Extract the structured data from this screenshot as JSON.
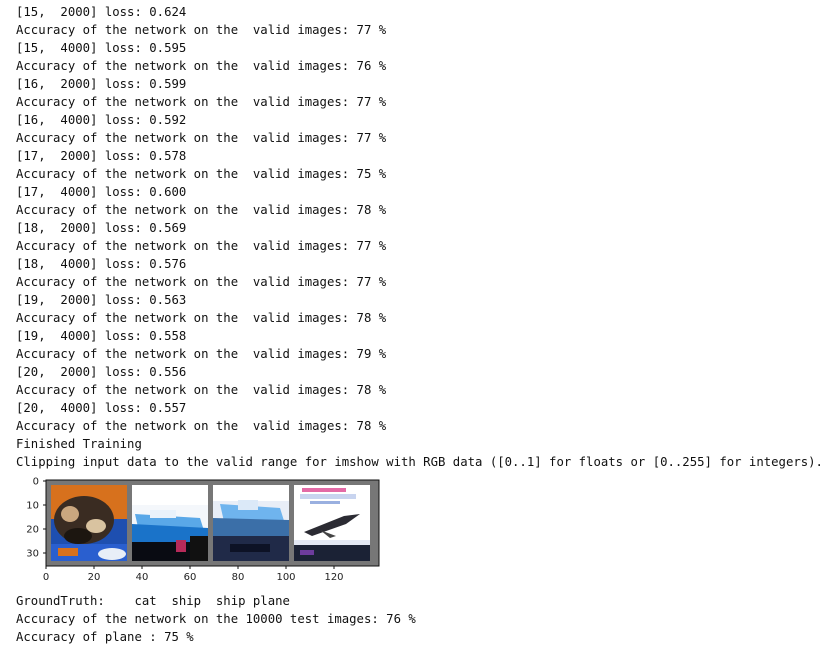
{
  "log_lines": [
    "[15,  2000] loss: 0.624",
    "Accuracy of the network on the  valid images: 77 %",
    "[15,  4000] loss: 0.595",
    "Accuracy of the network on the  valid images: 76 %",
    "[16,  2000] loss: 0.599",
    "Accuracy of the network on the  valid images: 77 %",
    "[16,  4000] loss: 0.592",
    "Accuracy of the network on the  valid images: 77 %",
    "[17,  2000] loss: 0.578",
    "Accuracy of the network on the  valid images: 75 %",
    "[17,  4000] loss: 0.600",
    "Accuracy of the network on the  valid images: 78 %",
    "[18,  2000] loss: 0.569",
    "Accuracy of the network on the  valid images: 77 %",
    "[18,  4000] loss: 0.576",
    "Accuracy of the network on the  valid images: 77 %",
    "[19,  2000] loss: 0.563",
    "Accuracy of the network on the  valid images: 78 %",
    "[19,  4000] loss: 0.558",
    "Accuracy of the network on the  valid images: 79 %",
    "[20,  2000] loss: 0.556",
    "Accuracy of the network on the  valid images: 78 %",
    "[20,  4000] loss: 0.557",
    "Accuracy of the network on the  valid images: 78 %",
    "Finished Training",
    "Clipping input data to the valid range for imshow with RGB data ([0..1] for floats or [0..255] for integers)."
  ],
  "image_grid": {
    "y_ticks": [
      "0",
      "10",
      "20",
      "30"
    ],
    "x_ticks": [
      "0",
      "20",
      "40",
      "60",
      "80",
      "100",
      "120"
    ],
    "frame_color": "#777777",
    "tiles": [
      "cat",
      "ship",
      "ship",
      "plane"
    ]
  },
  "tail_lines": [
    "GroundTruth:    cat  ship  ship plane",
    "Accuracy of the network on the 10000 test images: 76 %",
    "Accuracy of plane : 75 %"
  ]
}
